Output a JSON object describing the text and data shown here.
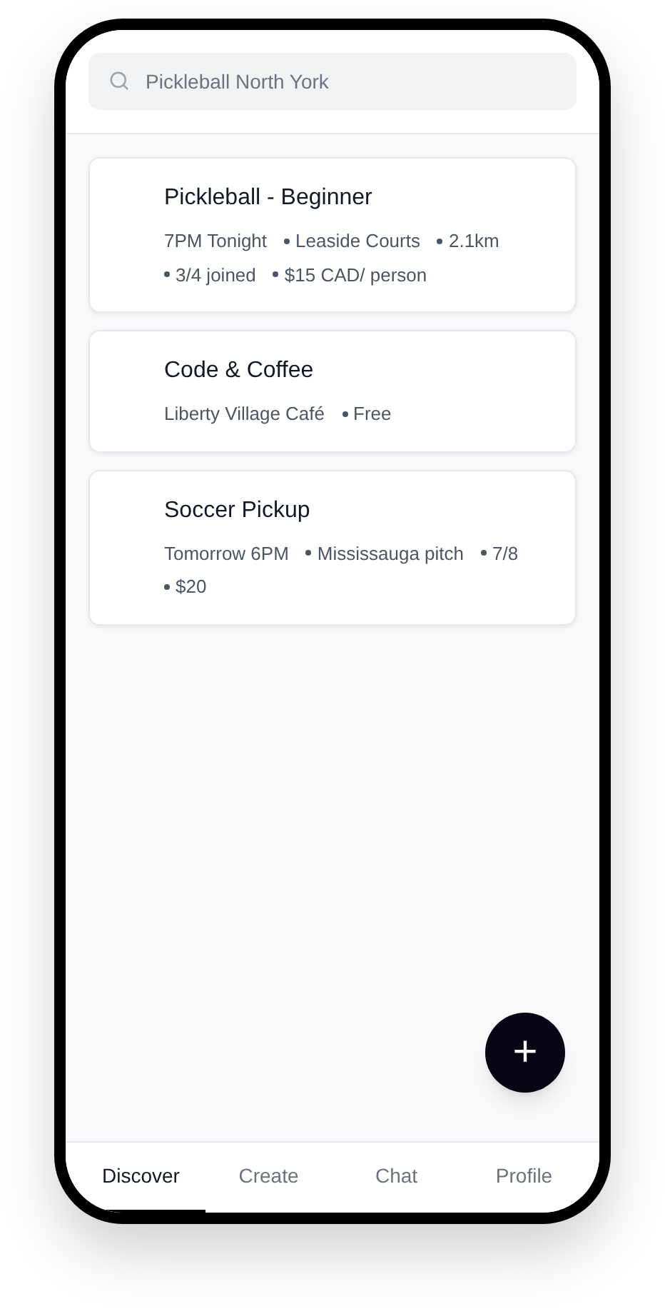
{
  "search": {
    "placeholder": "Pickleball North York"
  },
  "events": [
    {
      "title": "Pickleball - Beginner",
      "meta": [
        "7PM Tonight",
        "Leaside Courts",
        "2.1km",
        "3/4 joined",
        "$15 CAD/ person"
      ]
    },
    {
      "title": "Code & Coffee",
      "meta": [
        "Liberty Village Café",
        "Free"
      ]
    },
    {
      "title": "Soccer Pickup",
      "meta": [
        "Tomorrow 6PM",
        "Mississauga pitch",
        "7/8",
        "$20"
      ]
    }
  ],
  "fab": {
    "label": "+"
  },
  "tabs": [
    {
      "label": "Discover",
      "selected": true
    },
    {
      "label": "Create",
      "selected": false
    },
    {
      "label": "Chat",
      "selected": false
    },
    {
      "label": "Profile",
      "selected": false
    }
  ]
}
